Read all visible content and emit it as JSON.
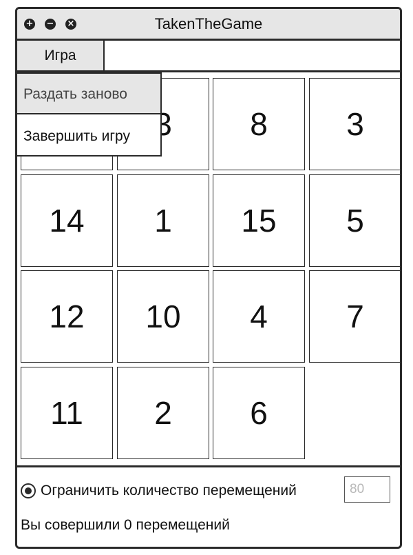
{
  "window": {
    "title": "TakenTheGame",
    "controls": {
      "maximize_glyph": "+",
      "minimize_glyph": "−",
      "close_glyph": "×"
    }
  },
  "menu": {
    "game_label": "Игра",
    "dropdown": {
      "items": [
        "Раздать заново",
        "Завершить игру"
      ]
    }
  },
  "board": {
    "tiles": [
      "",
      "3",
      "8",
      "3",
      "14",
      "1",
      "15",
      "5",
      "12",
      "10",
      "4",
      "7",
      "11",
      "2",
      "6"
    ]
  },
  "settings": {
    "limit_label": "Ограничить количество перемещений",
    "limit_value": "80",
    "moves_text": "Вы совершили 0 перемещений"
  }
}
